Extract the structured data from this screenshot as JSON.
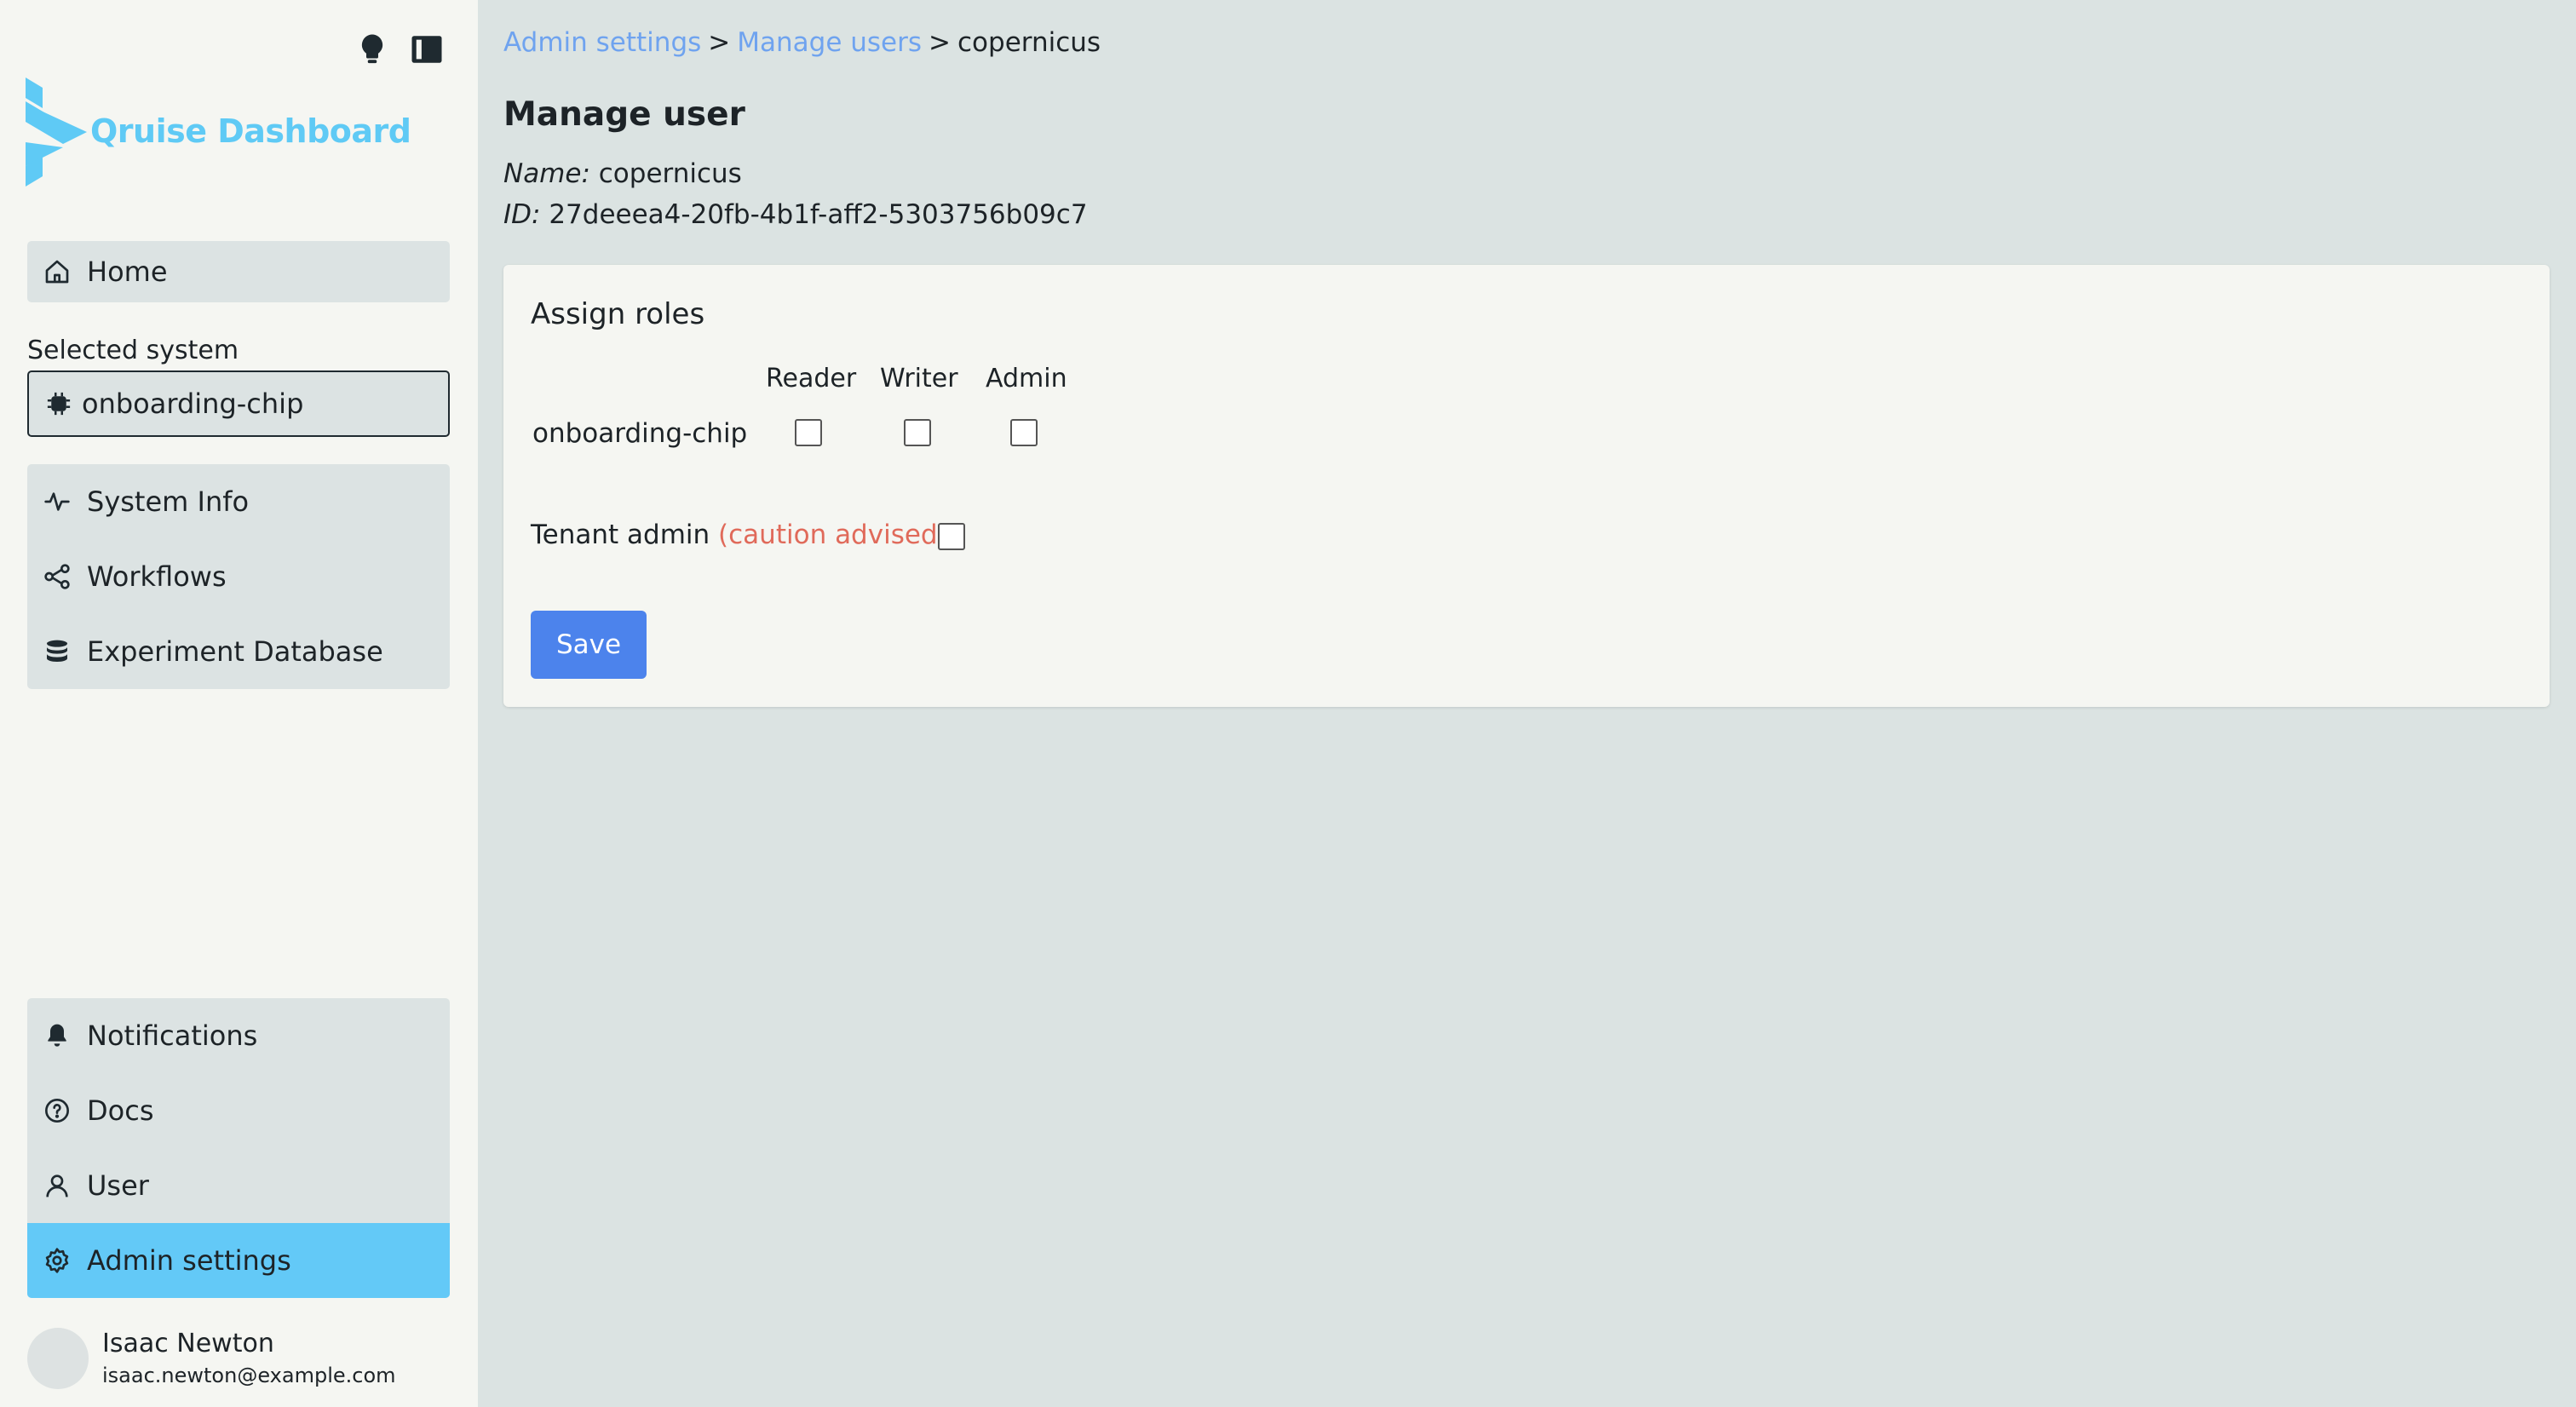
{
  "app": {
    "title": "Qruise Dashboard",
    "brand_color": "#5fcaf5",
    "accent_color": "#63c9f7"
  },
  "sidebar": {
    "top_icons": [
      "lightbulb-icon",
      "sidebar-toggle-icon"
    ],
    "home": {
      "label": "Home",
      "icon": "home-icon"
    },
    "selected_system_label": "Selected system",
    "selected_system": {
      "value": "onboarding-chip",
      "icon": "chip-icon"
    },
    "system_items": [
      {
        "label": "System Info",
        "icon": "activity-icon"
      },
      {
        "label": "Workflows",
        "icon": "share-nodes-icon"
      },
      {
        "label": "Experiment Database",
        "icon": "database-icon"
      }
    ],
    "bottom_items": [
      {
        "label": "Notifications",
        "icon": "bell-icon"
      },
      {
        "label": "Docs",
        "icon": "question-circle-icon"
      },
      {
        "label": "User",
        "icon": "user-icon"
      },
      {
        "label": "Admin settings",
        "icon": "gear-icon",
        "active": true
      }
    ],
    "user": {
      "name": "Isaac Newton",
      "email": "isaac.newton@example.com"
    }
  },
  "main": {
    "breadcrumb": {
      "items": [
        "Admin settings",
        "Manage users",
        "copernicus"
      ],
      "separator": ">"
    },
    "title": "Manage user",
    "name_label": "Name:",
    "name_value": "copernicus",
    "id_label": "ID:",
    "id_value": "27deeea4-20fb-4b1f-aff2-5303756b09c7",
    "assign_roles": {
      "title": "Assign roles",
      "columns": [
        "Reader",
        "Writer",
        "Admin"
      ],
      "rows": [
        {
          "system": "onboarding-chip",
          "reader": false,
          "writer": false,
          "admin": false
        }
      ]
    },
    "tenant_admin": {
      "label": "Tenant admin",
      "caution": "(caution advised)",
      "suffix": ":",
      "checked": false
    },
    "save_label": "Save",
    "save_color": "#4c83ec"
  }
}
